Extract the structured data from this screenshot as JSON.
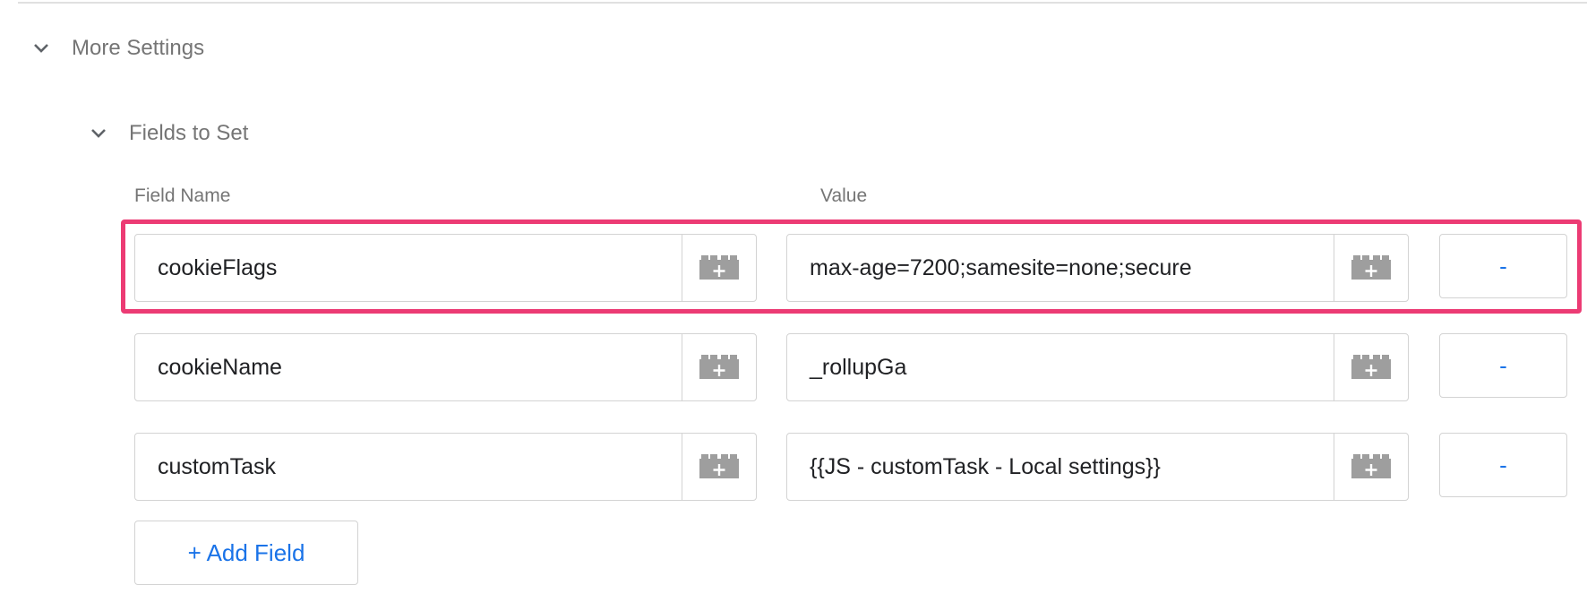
{
  "more_settings": {
    "title": "More Settings",
    "icon": "chevron-down-icon"
  },
  "fields_to_set": {
    "title": "Fields to Set",
    "icon": "chevron-down-icon",
    "columns": {
      "name": "Field Name",
      "value": "Value"
    },
    "rows": [
      {
        "name": "cookieFlags",
        "value": "max-age=7200;samesite=none;secure",
        "remove_label": "-",
        "highlighted": true
      },
      {
        "name": "cookieName",
        "value": "_rollupGa",
        "remove_label": "-",
        "highlighted": false
      },
      {
        "name": "customTask",
        "value": "{{JS - customTask - Local settings}}",
        "remove_label": "-",
        "highlighted": false
      }
    ],
    "add_label": "+ Add Field",
    "variable_icon": "variable-picker-icon"
  },
  "colors": {
    "accent": "#1a73e8",
    "highlight": "#ec3b74",
    "icon_gray": "#9e9e9e"
  }
}
